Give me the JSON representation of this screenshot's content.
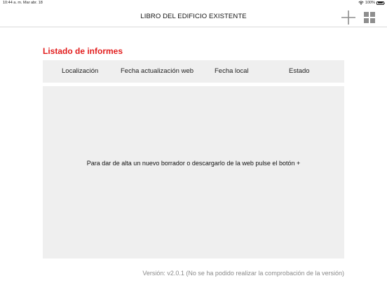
{
  "status_bar": {
    "time": "10:44 a. m.",
    "date": "Mar abr. 18",
    "battery": "100%"
  },
  "nav": {
    "title": "LIBRO DEL EDIFICIO EXISTENTE",
    "add_icon": "plus-icon",
    "grid_icon": "grid-icon"
  },
  "list": {
    "title": "Listado de informes",
    "columns": [
      "Localización",
      "Fecha actualización web",
      "Fecha local",
      "Estado"
    ],
    "empty_message": "Para dar de alta un nuevo borrador o descargarlo de la web pulse el botón +"
  },
  "footer": {
    "version": "Versión:  v2.0.1 (No se ha podido realizar la comprobación de la versión)"
  },
  "colors": {
    "accent": "#e21d1d",
    "panel": "#efefef",
    "muted_text": "#8a8a8a"
  }
}
